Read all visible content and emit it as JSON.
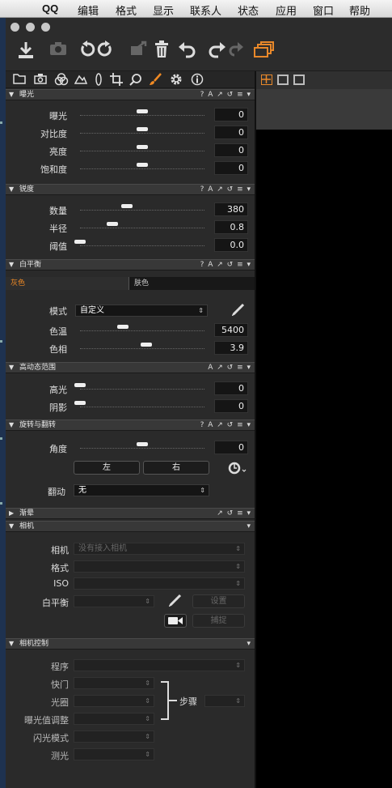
{
  "menubar": {
    "apple": "",
    "items": [
      "QQ",
      "编辑",
      "格式",
      "显示",
      "联系人",
      "状态",
      "应用",
      "窗口",
      "帮助"
    ]
  },
  "toolbar": {
    "icons": [
      "import-icon",
      "camera-icon",
      "rotate-left-icon",
      "rotate-right-icon",
      "move-icon",
      "trash-icon",
      "undo-icon",
      "redo-icon",
      "forward-icon",
      "variants-icon"
    ]
  },
  "tools_tabs": [
    "library-icon",
    "capture-icon",
    "color-icon",
    "exposure-icon",
    "lens-icon",
    "crop-icon",
    "focus-icon",
    "adjust-icon",
    "settings-icon",
    "info-icon"
  ],
  "panels": {
    "exposure": {
      "title": "曝光",
      "icons": "? A ↗ ↺ ≡ ▾",
      "rows": [
        {
          "label": "曝光",
          "value": "0",
          "pos": 0.5
        },
        {
          "label": "对比度",
          "value": "0",
          "pos": 0.5
        },
        {
          "label": "亮度",
          "value": "0",
          "pos": 0.5
        },
        {
          "label": "饱和度",
          "value": "0",
          "pos": 0.5
        }
      ]
    },
    "sharpening": {
      "title": "锐度",
      "icons": "? A ↗ ↺ ≡ ▾",
      "rows": [
        {
          "label": "数量",
          "value": "380",
          "pos": 0.38
        },
        {
          "label": "半径",
          "value": "0.8",
          "pos": 0.26
        },
        {
          "label": "阈值",
          "value": "0.0",
          "pos": 0.0
        }
      ]
    },
    "white_balance": {
      "title": "白平衡",
      "icons": "? A ↗ ↺ ≡ ▾",
      "tabs": [
        "灰色",
        "肤色"
      ],
      "mode_label": "模式",
      "mode_value": "自定义",
      "rows": [
        {
          "label": "色温",
          "value": "5400",
          "pos": 0.34
        },
        {
          "label": "色相",
          "value": "3.9",
          "pos": 0.56
        }
      ]
    },
    "hdr": {
      "title": "高动态范围",
      "icons": "A ↗ ↺ ≡ ▾",
      "rows": [
        {
          "label": "高光",
          "value": "0",
          "pos": 0.0
        },
        {
          "label": "阴影",
          "value": "0",
          "pos": 0.0
        }
      ]
    },
    "rotation": {
      "title": "旋转与翻转",
      "icons": "? A ↗ ↺ ≡ ▾",
      "rows": [
        {
          "label": "角度",
          "value": "0",
          "pos": 0.5
        }
      ],
      "left_button": "左",
      "right_button": "右",
      "flip_label": "翻动",
      "flip_value": "无"
    },
    "vignette": {
      "title": "渐晕",
      "icons": "↗ ↺ ≡ ▾"
    },
    "camera": {
      "title": "相机",
      "icons": "▾",
      "camera_label": "相机",
      "camera_value": "没有接入相机",
      "format_label": "格式",
      "iso_label": "ISO",
      "wb_label": "白平衡",
      "set_button": "设置",
      "capture_button": "捕捉"
    },
    "camera_control": {
      "title": "相机控制",
      "icons": "▾",
      "program_label": "程序",
      "shutter_label": "快门",
      "aperture_label": "光圈",
      "ev_label": "曝光值调整",
      "step_label": "步骤",
      "flash_label": "闪光模式",
      "metering_label": "测光"
    }
  }
}
